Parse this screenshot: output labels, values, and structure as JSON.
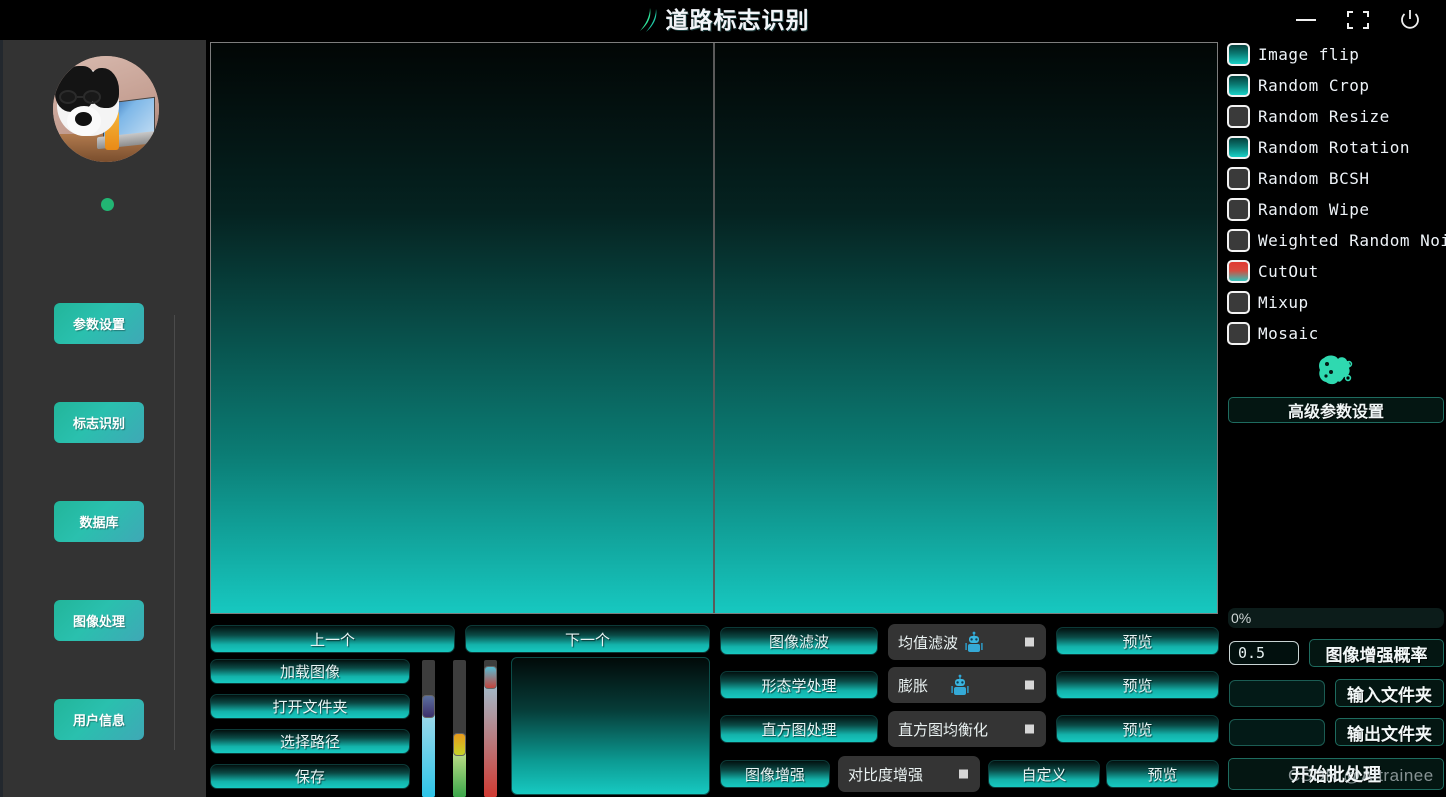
{
  "window": {
    "title": "道路标志识别",
    "logo_icon": "road-swoosh-logo",
    "controls": {
      "minimize": "minimize-icon",
      "maximize": "maximize-icon",
      "power": "power-icon"
    }
  },
  "sidebar": {
    "avatar_alt": "user-avatar-dog-with-laptop",
    "status": "online",
    "items": [
      {
        "label": "参数设置",
        "name": "parameter-settings"
      },
      {
        "label": "标志识别",
        "name": "sign-recognition"
      },
      {
        "label": "数据库",
        "name": "database"
      },
      {
        "label": "图像处理",
        "name": "image-processing"
      },
      {
        "label": "用户信息",
        "name": "user-info"
      }
    ]
  },
  "stage": {
    "panels": [
      {
        "name": "original-image-panel"
      },
      {
        "name": "processed-image-panel"
      }
    ]
  },
  "nav": {
    "previous": "上一个",
    "next": "下一个"
  },
  "file_actions": [
    {
      "label": "加载图像",
      "name": "load-image"
    },
    {
      "label": "打开文件夹",
      "name": "open-folder"
    },
    {
      "label": "选择路径",
      "name": "choose-path"
    },
    {
      "label": "保存",
      "name": "save"
    }
  ],
  "sliders": [
    {
      "name": "slider-a",
      "value": 61
    },
    {
      "name": "slider-b",
      "value": 34
    },
    {
      "name": "slider-c",
      "value": 89
    }
  ],
  "processing": {
    "rows": [
      {
        "action": "图像滤波",
        "action_name": "image-filter",
        "selected": "均值滤波",
        "select_name": "filter-method-select",
        "preview": "预览"
      },
      {
        "action": "形态学处理",
        "action_name": "morphology",
        "selected": "膨胀",
        "select_name": "morphology-method-select",
        "preview": "预览"
      },
      {
        "action": "直方图处理",
        "action_name": "histogram",
        "selected": "直方图均衡化",
        "select_name": "histogram-method-select",
        "preview": "预览"
      }
    ],
    "enhance": {
      "action": "图像增强",
      "action_name": "image-enhance",
      "selected": "对比度增强",
      "select_name": "enhance-method-select",
      "custom": "自定义",
      "preview": "预览"
    },
    "robot_icon": "robot-icon"
  },
  "augment": {
    "options": [
      {
        "label": "Image flip",
        "checked": true
      },
      {
        "label": "Random Crop",
        "checked": true
      },
      {
        "label": "Random Resize",
        "checked": false
      },
      {
        "label": "Random Rotation",
        "checked": true
      },
      {
        "label": "Random BCSH",
        "checked": false
      },
      {
        "label": "Random Wipe",
        "checked": false
      },
      {
        "label": "Weighted Random Noise",
        "checked": false
      },
      {
        "label": "CutOut",
        "checked": true,
        "style": "cut"
      },
      {
        "label": "Mixup",
        "checked": false
      },
      {
        "label": "Mosaic",
        "checked": false
      }
    ],
    "brain_icon": "brain-ai-icon",
    "advanced_button": "高级参数设置",
    "progress_text": "0%",
    "progress_value": 0,
    "probability_value": "0.5",
    "probability_label": "图像增强概率",
    "input_folder_value": "",
    "input_folder_label": "输入文件夹",
    "output_folder_value": "",
    "output_folder_label": "输出文件夹",
    "batch_button": "开始批处理"
  },
  "watermark": "CSDN @AItrainee",
  "colors": {
    "accent_teal": "#17c9c1",
    "accent_dark": "#0a4a46",
    "sidebar_bg": "#333333",
    "status_green": "#22b573",
    "cutout_red": "#e03a32"
  }
}
